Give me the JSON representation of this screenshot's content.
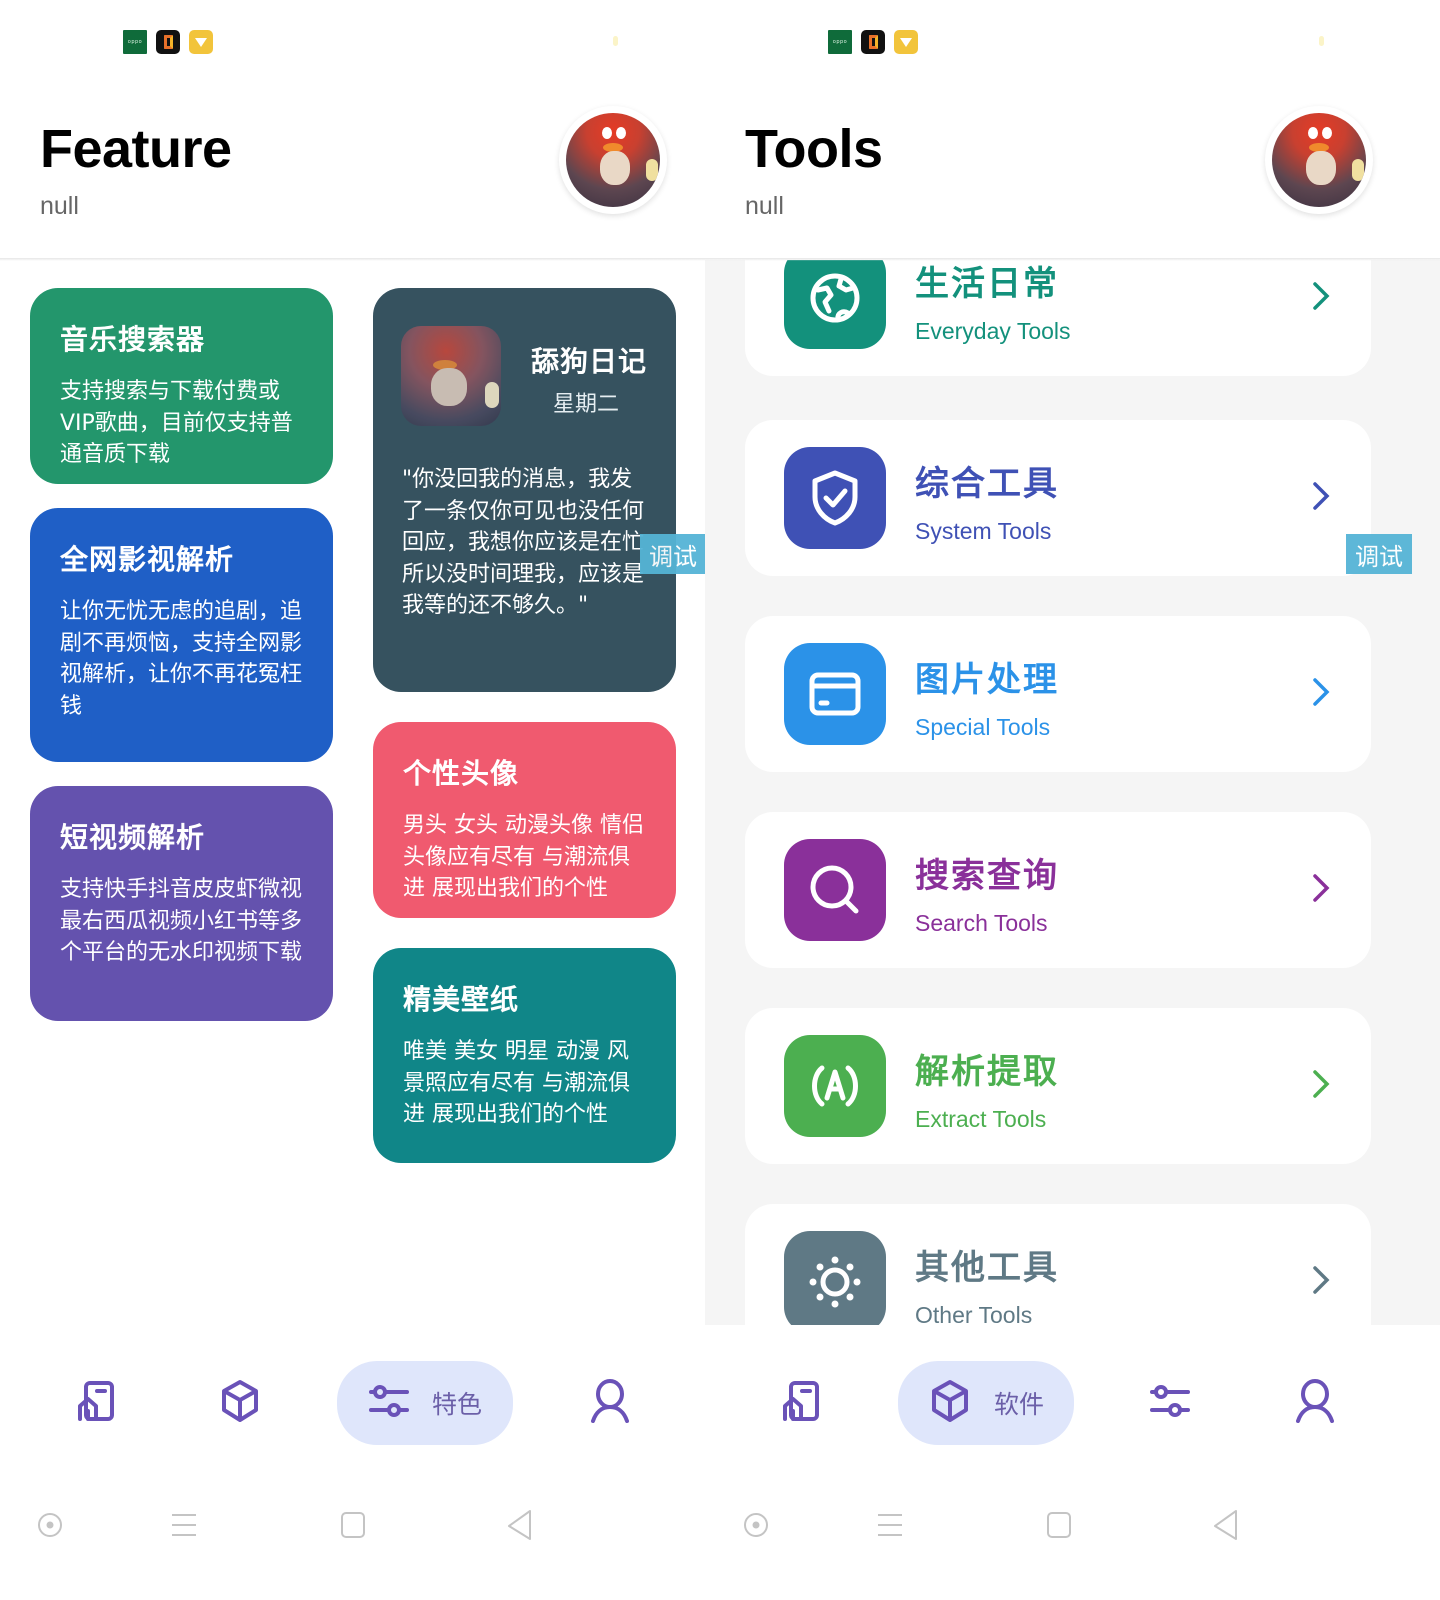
{
  "colors": {
    "accent_purple": "#6a52b8",
    "nav_active_bg": "#dfe6fb",
    "debug_badge": "#55b4d6",
    "list_bg": "#f5f5f5"
  },
  "status_bar": {
    "icons": [
      "oppo-app-icon",
      "black-orange-app-icon",
      "yellow-diamond-app-icon"
    ],
    "oppo_text": "oppo"
  },
  "debug_badge": "调试",
  "feature_screen": {
    "header": {
      "title": "Feature",
      "subtitle": "null"
    },
    "cards": [
      {
        "title": "音乐搜索器",
        "desc": "支持搜索与下载付费或VIP歌曲，目前仅支持普通音质下载",
        "color": "#23966c"
      },
      {
        "title": "全网影视解析",
        "desc": "让你无忧无虑的追剧，追剧不再烦恼，支持全网影视解析，让你不再花冤枉钱",
        "color": "#1f5fc6"
      },
      {
        "title": "短视频解析",
        "desc": "支持快手抖音皮皮虾微视最右西瓜视频小红书等多个平台的无水印视频下载",
        "color": "#6452ae"
      },
      {
        "title": "舔狗日记",
        "day": "星期二",
        "desc": "\"你没回我的消息，我发了一条仅你可见也没任何回应，我想你应该是在忙所以没时间理我，应该是我等的还不够久。\"",
        "color": "#36525f"
      },
      {
        "title": "个性头像",
        "desc": "男头 女头 动漫头像 情侣头像应有尽有 与潮流俱进 展现出我们的个性",
        "color": "#f05a6f"
      },
      {
        "title": "精美壁纸",
        "desc": "唯美 美女 明星 动漫 风景照应有尽有 与潮流俱进 展现出我们的个性",
        "color": "#108688"
      }
    ],
    "nav": {
      "items": [
        {
          "icon": "home-icon",
          "label": ""
        },
        {
          "icon": "cube-icon",
          "label": ""
        },
        {
          "icon": "sliders-icon",
          "label": "特色",
          "active": true
        },
        {
          "icon": "user-icon",
          "label": ""
        }
      ]
    }
  },
  "tools_screen": {
    "header": {
      "title": "Tools",
      "subtitle": "null"
    },
    "tools": [
      {
        "title": "生活日常",
        "subtitle": "Everyday Tools",
        "icon": "globe-icon",
        "color": "#13917c"
      },
      {
        "title": "综合工具",
        "subtitle": "System Tools",
        "icon": "shield-check-icon",
        "color": "#3f51b5"
      },
      {
        "title": "图片处理",
        "subtitle": "Special Tools",
        "icon": "card-icon",
        "color": "#2b92e8"
      },
      {
        "title": "搜索查询",
        "subtitle": "Search Tools",
        "icon": "search-icon",
        "color": "#8a309a"
      },
      {
        "title": "解析提取",
        "subtitle": "Extract Tools",
        "icon": "at-letter-icon",
        "color": "#4caf50"
      },
      {
        "title": "其他工具",
        "subtitle": "Other Tools",
        "icon": "sun-icon",
        "color": "#5f7985"
      }
    ],
    "nav": {
      "items": [
        {
          "icon": "home-icon",
          "label": ""
        },
        {
          "icon": "cube-icon",
          "label": "软件",
          "active": true
        },
        {
          "icon": "sliders-icon",
          "label": ""
        },
        {
          "icon": "user-icon",
          "label": ""
        }
      ]
    }
  },
  "system_nav": [
    "assistant-button",
    "menu-button",
    "home-button",
    "back-button"
  ]
}
